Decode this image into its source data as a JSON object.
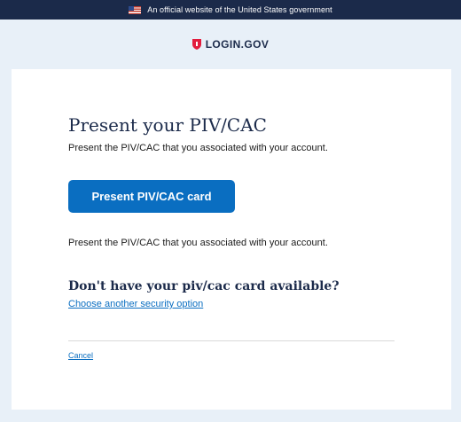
{
  "banner": {
    "icon": "us-flag-icon",
    "text": "An official website of the United States government"
  },
  "header": {
    "logo_icon": "shield-icon",
    "logo_text": "LOGIN.GOV"
  },
  "main": {
    "title": "Present your PIV/CAC",
    "intro": "Present the PIV/CAC that you associated with your account.",
    "button_label": "Present PIV/CAC card",
    "secondary_text": "Present the PIV/CAC that you associated with your account.",
    "alt_heading": "Don't have your piv/cac card available?",
    "alt_link": "Choose another security option",
    "cancel_link": "Cancel"
  },
  "colors": {
    "banner_bg": "#1b2a4a",
    "page_bg": "#e8f0f8",
    "primary": "#0a6ec1",
    "heading": "#1b2a4a",
    "logo_red": "#e21c3d"
  }
}
